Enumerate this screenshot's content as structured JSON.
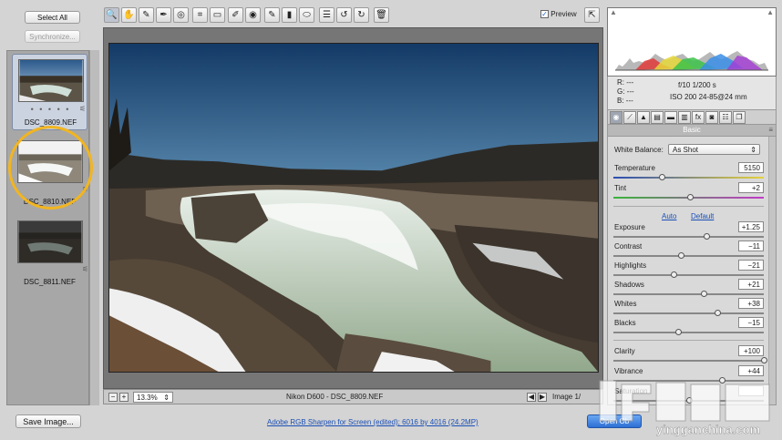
{
  "left": {
    "select_all": "Select All",
    "synchronize": "Synchronize..."
  },
  "filmstrip": [
    {
      "name": "DSC_8809.NEF",
      "dots": "• • • • •",
      "selected": true
    },
    {
      "name": "DSC_8810.NEF",
      "selected": false
    },
    {
      "name": "DSC_8811.NEF",
      "selected": false
    }
  ],
  "toolbar": {
    "tools": [
      {
        "icon": "zoom-icon",
        "glyph": "🔍"
      },
      {
        "icon": "hand-icon",
        "glyph": "✋"
      },
      {
        "icon": "white-balance-icon",
        "glyph": "✎"
      },
      {
        "icon": "color-sampler-icon",
        "glyph": "✒"
      },
      {
        "icon": "target-adjust-icon",
        "glyph": "◎"
      },
      {
        "icon": "crop-icon",
        "glyph": "⌗"
      },
      {
        "icon": "straighten-icon",
        "glyph": "▭"
      },
      {
        "icon": "spot-removal-icon",
        "glyph": "✐"
      },
      {
        "icon": "red-eye-icon",
        "glyph": "◉"
      },
      {
        "icon": "adjustment-brush-icon",
        "glyph": "✎"
      },
      {
        "icon": "graduated-filter-icon",
        "glyph": "▮"
      },
      {
        "icon": "radial-filter-icon",
        "glyph": "⬭"
      },
      {
        "icon": "preferences-icon",
        "glyph": "☰"
      },
      {
        "icon": "rotate-left-icon",
        "glyph": "↺"
      },
      {
        "icon": "rotate-right-icon",
        "glyph": "↻"
      },
      {
        "icon": "trash-icon",
        "glyph": "🗑"
      }
    ],
    "preview_label": "Preview"
  },
  "status": {
    "zoom": "13.3%",
    "camera": "Nikon D600  -  DSC_8809.NEF",
    "image_count": "Image 1/"
  },
  "info": {
    "r": "R:   ---",
    "g": "G:   ---",
    "b": "B:   ---",
    "exposure": "f/10   1/200 s",
    "lens": "ISO 200   24-85@24 mm"
  },
  "panel": {
    "header": "Basic",
    "white_balance_label": "White Balance:",
    "white_balance_value": "As Shot",
    "temperature": {
      "label": "Temperature",
      "value": "5150",
      "level": 0.32
    },
    "tint": {
      "label": "Tint",
      "value": "+2",
      "level": 0.51
    },
    "auto": "Auto",
    "default": "Default",
    "sliders": [
      {
        "label": "Exposure",
        "value": "+1.25",
        "level": 0.62
      },
      {
        "label": "Contrast",
        "value": "−11",
        "level": 0.45
      },
      {
        "label": "Highlights",
        "value": "−21",
        "level": 0.4
      },
      {
        "label": "Shadows",
        "value": "+21",
        "level": 0.6
      },
      {
        "label": "Whites",
        "value": "+38",
        "level": 0.69
      },
      {
        "label": "Blacks",
        "value": "−15",
        "level": 0.43
      }
    ],
    "presence": [
      {
        "label": "Clarity",
        "value": "+100",
        "level": 1.0
      },
      {
        "label": "Vibrance",
        "value": "+44",
        "level": 0.72
      },
      {
        "label": "Saturation",
        "value": "",
        "level": 0.5
      }
    ]
  },
  "bottom": {
    "save_image": "Save Image...",
    "workflow": "Adobe RGB Sharpen for Screen (edited); 6016 by 4016 (24.2MP)",
    "open": "Open Ob"
  },
  "watermark": "yingganchina.com"
}
